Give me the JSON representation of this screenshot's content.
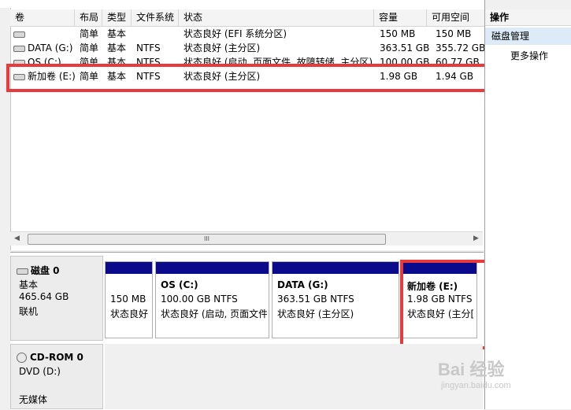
{
  "columns": [
    "卷",
    "布局",
    "类型",
    "文件系统",
    "状态",
    "容量",
    "可用空间"
  ],
  "volumes": [
    {
      "name": "",
      "layout": "简单",
      "type": "基本",
      "fs": "",
      "status": "状态良好 (EFI 系统分区)",
      "capacity": "150 MB",
      "free": "150 MB"
    },
    {
      "name": "DATA (G:)",
      "layout": "简单",
      "type": "基本",
      "fs": "NTFS",
      "status": "状态良好 (主分区)",
      "capacity": "363.51 GB",
      "free": "355.72 GB"
    },
    {
      "name": "OS (C:)",
      "layout": "简单",
      "type": "基本",
      "fs": "NTFS",
      "status": "状态良好 (启动, 页面文件, 故障转储, 主分区)",
      "capacity": "100.00 GB",
      "free": "60.77 GB"
    },
    {
      "name": "新加卷 (E:)",
      "layout": "简单",
      "type": "基本",
      "fs": "NTFS",
      "status": "状态良好 (主分区)",
      "capacity": "1.98 GB",
      "free": "1.94 GB"
    }
  ],
  "scroll_grip": "III",
  "disks": [
    {
      "name": "磁盘 0",
      "type": "基本",
      "size": "465.64 GB",
      "state": "联机",
      "partitions": [
        {
          "title": "",
          "line1": "150 MB",
          "line2": "状态良好"
        },
        {
          "title": "OS  (C:)",
          "line1": "100.00 GB NTFS",
          "line2": "状态良好 (启动, 页面文件"
        },
        {
          "title": "DATA  (G:)",
          "line1": "363.51 GB NTFS",
          "line2": "状态良好 (主分区)"
        },
        {
          "title": "新加卷  (E:)",
          "line1": "1.98 GB NTFS",
          "line2": "状态良好 (主分["
        }
      ]
    },
    {
      "name": "CD-ROM 0",
      "type": "DVD (D:)",
      "size": "",
      "state": "无媒体"
    }
  ],
  "actions": {
    "header": "操作",
    "selected": "磁盘管理",
    "more": "更多操作"
  },
  "watermark": {
    "brand": "Bai 经验",
    "url": "jingyan.baidu.com"
  },
  "colors": {
    "highlight": "#e83a3a",
    "partition_bar": "#0a0a8a",
    "selection": "#ddeaf7"
  }
}
